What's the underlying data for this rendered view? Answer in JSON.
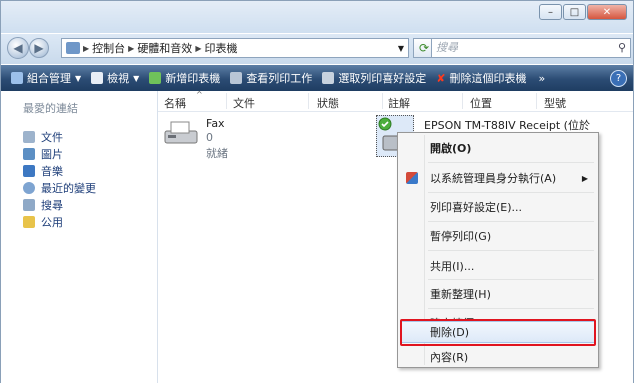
{
  "window": {
    "minimize": "–",
    "maximize": "□",
    "close": "✕"
  },
  "address": {
    "crumbs": [
      "控制台",
      "硬體和音效",
      "印表機"
    ],
    "search_placeholder": "搜尋"
  },
  "toolbar": {
    "organize": "組合管理",
    "views": "檢視",
    "add_printer": "新增印表機",
    "see_queue": "查看列印工作",
    "prefs": "選取列印喜好設定",
    "delete_printer": "刪除這個印表機",
    "more": "»"
  },
  "nav": {
    "title": "最愛的連結",
    "items": [
      "文件",
      "圖片",
      "音樂",
      "最近的變更",
      "搜尋",
      "公用"
    ]
  },
  "columns": [
    "名稱",
    "文件",
    "狀態",
    "註解",
    "位置",
    "型號"
  ],
  "items": {
    "fax": {
      "name": "Fax",
      "docs": "0",
      "status": "就緒"
    },
    "epson": {
      "name": "EPSON TM-T88IV Receipt (位於"
    }
  },
  "context_menu": [
    {
      "label": "開啟(O)",
      "bold": true
    },
    {
      "label": "以系統管理員身分執行(A)",
      "submenu": true
    },
    {
      "label": "列印喜好設定(E)..."
    },
    {
      "label": "暫停列印(G)"
    },
    {
      "label": "共用(I)..."
    },
    {
      "label": "重新整理(H)"
    },
    {
      "label": "建立捷徑(S)"
    },
    {
      "label": "刪除(D)",
      "highlighted": true
    },
    {
      "label": "內容(R)"
    }
  ],
  "colors": {
    "toolbar": "#2b4c74",
    "highlight_border": "#e0141f",
    "link": "#1f3f7a"
  }
}
